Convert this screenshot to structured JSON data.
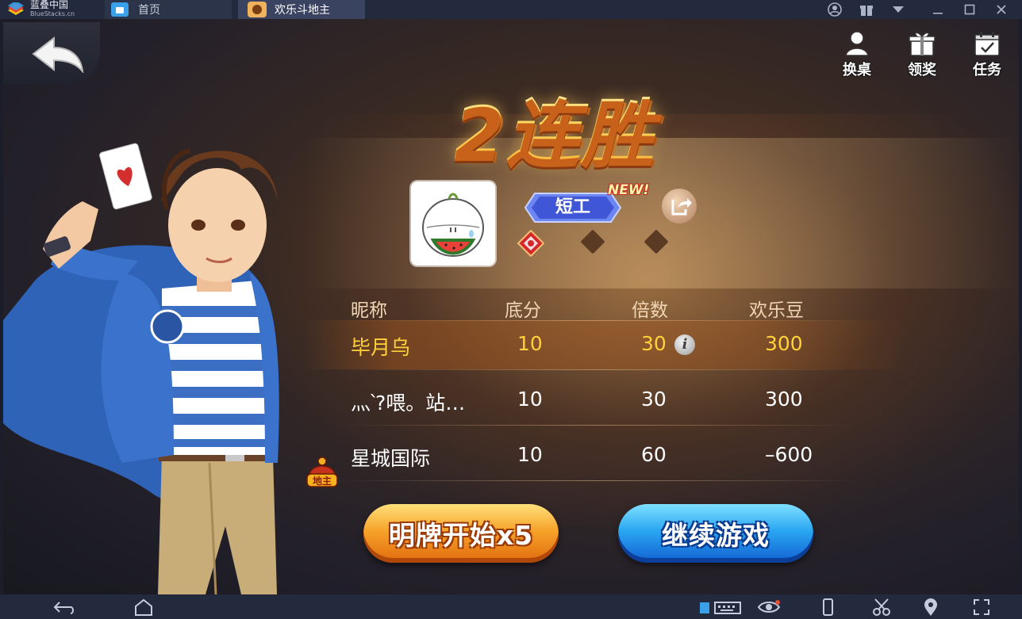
{
  "emulator": {
    "brand_cn": "蓝叠中国",
    "brand_en": "BlueStacks.cn",
    "tabs": [
      {
        "label": "首页"
      },
      {
        "label": "欢乐斗地主"
      }
    ],
    "window_controls": [
      "account-icon",
      "gift-icon",
      "dropdown-icon",
      "minimize-icon",
      "maximize-icon",
      "close-icon"
    ],
    "bottom_icons": [
      "back-icon",
      "home-icon",
      "keyboard-icon",
      "eye-icon",
      "rotate-icon",
      "scissors-icon",
      "location-icon",
      "fullscreen-icon"
    ]
  },
  "game": {
    "title": "2连胜",
    "top_buttons": [
      {
        "label": "换桌",
        "icon": "change-table-icon"
      },
      {
        "label": "领奖",
        "icon": "gift-icon"
      },
      {
        "label": "任务",
        "icon": "task-icon"
      }
    ],
    "profile": {
      "rank": "短工",
      "new_tag": "NEW!",
      "level_progress": {
        "filled": 1,
        "total": 3
      }
    },
    "table": {
      "headers": [
        "昵称",
        "底分",
        "倍数",
        "欢乐豆"
      ],
      "rows": [
        {
          "name": "毕月乌",
          "base": "10",
          "multiplier": "30",
          "beans": "300",
          "is_self": true,
          "landlord": false
        },
        {
          "name": "灬՝?喂。站…",
          "base": "10",
          "multiplier": "30",
          "beans": "300",
          "is_self": false,
          "landlord": false
        },
        {
          "name": "星城国际",
          "base": "10",
          "multiplier": "60",
          "beans": "–600",
          "is_self": false,
          "landlord": true
        }
      ],
      "landlord_badge": "地主"
    },
    "buttons": {
      "show_cards": "明牌开始x5",
      "continue": "继续游戏"
    },
    "colors": {
      "title_gold": "#ffd84a",
      "self_row_text": "#ffd23a",
      "orange_button": "#f6a32a",
      "blue_button": "#2aa7f2"
    }
  }
}
